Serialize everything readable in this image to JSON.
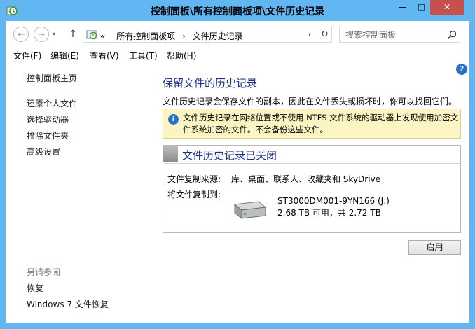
{
  "window": {
    "title": "控制面板\\所有控制面板项\\文件历史记录",
    "minimize_glyph": "—",
    "maximize_glyph": "□",
    "close_glyph": "✕"
  },
  "toolbar": {
    "back_glyph": "←",
    "forward_glyph": "→",
    "history_glyph": "▾",
    "up_glyph": "↑",
    "address": {
      "prefix": "«",
      "crumbs": [
        "所有控制面板项",
        "文件历史记录"
      ],
      "separator": "›",
      "dropdown_glyph": "▾",
      "refresh_glyph": "↻"
    },
    "search": {
      "placeholder": "搜索控制面板"
    }
  },
  "menu": {
    "file": "文件(F)",
    "edit": "编辑(E)",
    "view": "查看(V)",
    "tools": "工具(T)",
    "help": "帮助(H)"
  },
  "help_icon_glyph": "?",
  "sidebar": {
    "home": "控制面板主页",
    "items": [
      "还原个人文件",
      "选择驱动器",
      "排除文件夹",
      "高级设置"
    ],
    "see_also_heading": "另请参阅",
    "see_also": [
      "恢复",
      "Windows 7 文件恢复"
    ]
  },
  "main": {
    "title": "保留文件的历史记录",
    "description": "文件历史记录会保存文件的副本，因此在文件丢失或损坏时，你可以找回它们。",
    "info": {
      "icon_glyph": "i",
      "text": "文件历史记录在网络位置或不使用 NTFS 文件系统的驱动器上发现使用加密文件系统加密的文件。不会备份这些文件。"
    },
    "status": {
      "title": "文件历史记录已关闭",
      "source_label": "文件复制来源:",
      "source_value": "库、桌面、联系人、收藏夹和 SkyDrive",
      "dest_label": "将文件复制到:",
      "drive_name": "ST3000DM001-9YN166 (J:)",
      "drive_space": "2.68 TB 可用，共 2.72 TB"
    },
    "apply_label": "启用"
  },
  "colors": {
    "frame": "#62b6f2",
    "close": "#c7504c",
    "heading": "#1e3287",
    "info_bg": "#fcf4c2",
    "link": "#1c1c1c"
  }
}
